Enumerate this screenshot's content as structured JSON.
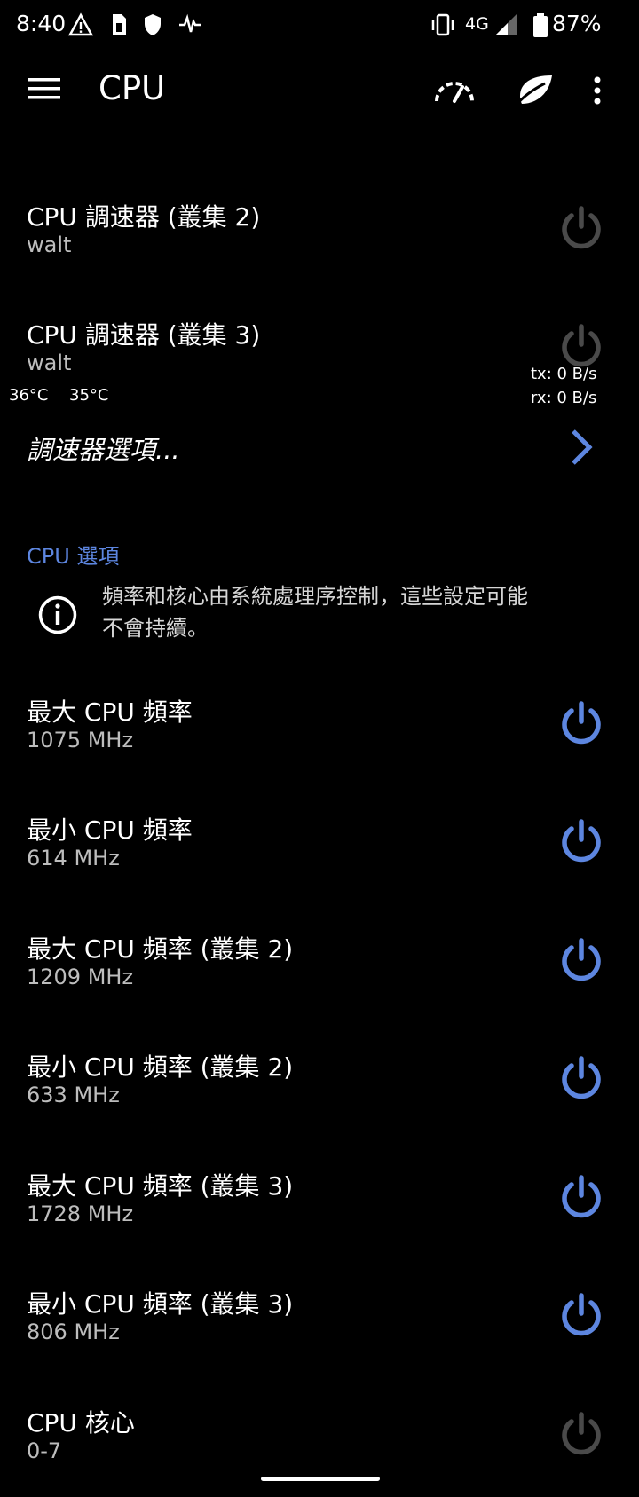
{
  "status_bar": {
    "time": "8:40",
    "network": "4G",
    "battery": "87%"
  },
  "app_bar": {
    "title": "CPU"
  },
  "items_top": [
    {
      "title": "CPU 調速器 (叢集 2)",
      "value": "walt"
    },
    {
      "title": "CPU 調速器 (叢集 3)",
      "value": "walt"
    }
  ],
  "overlay": {
    "temp1": "36°C",
    "temp2": "35°C",
    "tx": "tx: 0 B/s",
    "rx": "rx: 0 B/s"
  },
  "governor_options": "調速器選項...",
  "section": {
    "header": "CPU 選項",
    "info": "頻率和核心由系統處理序控制，這些設定可能不會持續。"
  },
  "freq_items": [
    {
      "title": "最大 CPU 頻率",
      "value": "1075 MHz"
    },
    {
      "title": "最小 CPU 頻率",
      "value": "614 MHz"
    },
    {
      "title": "最大 CPU 頻率 (叢集 2)",
      "value": "1209 MHz"
    },
    {
      "title": "最小 CPU 頻率 (叢集 2)",
      "value": "633 MHz"
    },
    {
      "title": "最大 CPU 頻率 (叢集 3)",
      "value": "1728 MHz"
    },
    {
      "title": "最小 CPU 頻率 (叢集 3)",
      "value": "806 MHz"
    }
  ],
  "cores_item": {
    "title": "CPU 核心",
    "value": "0-7"
  },
  "colors": {
    "background": "#000000",
    "accent": "#5d86e0",
    "power_inactive": "#4a4a4a"
  }
}
